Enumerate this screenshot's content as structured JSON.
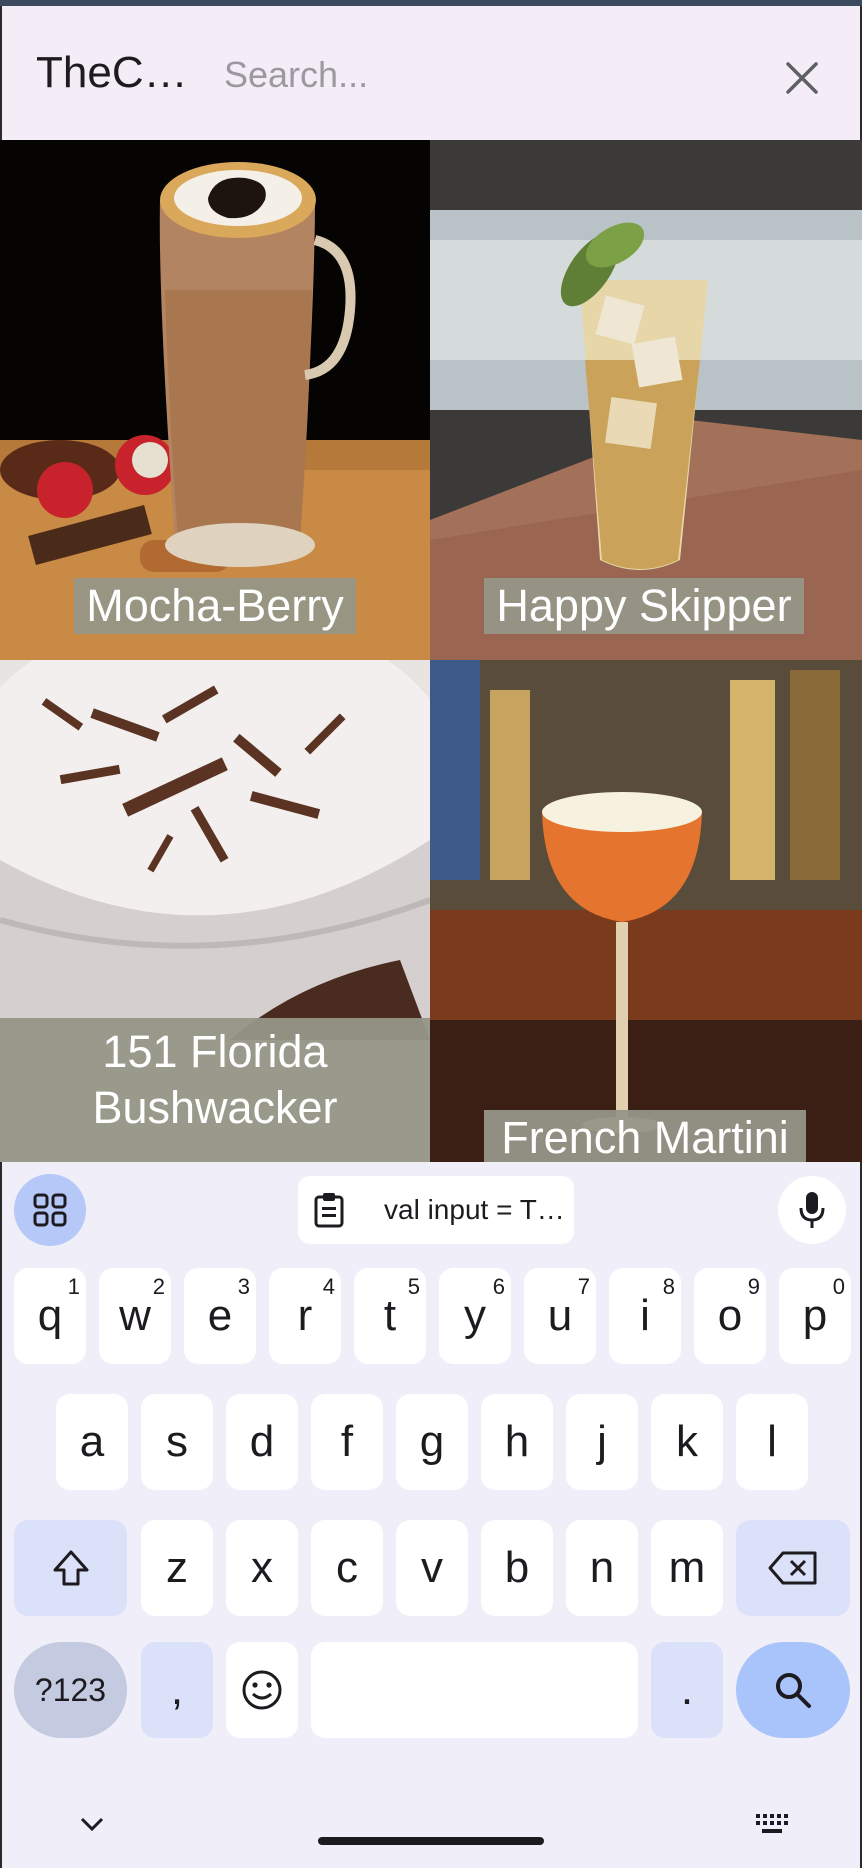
{
  "app": {
    "title": "TheC…",
    "search_placeholder": "Search...",
    "search_value": ""
  },
  "drinks": [
    {
      "name": "Mocha-Berry"
    },
    {
      "name": "Happy Skipper"
    },
    {
      "name": "151 Florida Bushwacker",
      "line1": "151 Florida",
      "line2": "Bushwacker"
    },
    {
      "name": "French Martini"
    }
  ],
  "keyboard": {
    "clipboard_text": "val input = T…",
    "row1": [
      {
        "label": "q",
        "hint": "1"
      },
      {
        "label": "w",
        "hint": "2"
      },
      {
        "label": "e",
        "hint": "3"
      },
      {
        "label": "r",
        "hint": "4"
      },
      {
        "label": "t",
        "hint": "5"
      },
      {
        "label": "y",
        "hint": "6"
      },
      {
        "label": "u",
        "hint": "7"
      },
      {
        "label": "i",
        "hint": "8"
      },
      {
        "label": "o",
        "hint": "9"
      },
      {
        "label": "p",
        "hint": "0"
      }
    ],
    "row2": [
      "a",
      "s",
      "d",
      "f",
      "g",
      "h",
      "j",
      "k",
      "l"
    ],
    "row3": [
      "z",
      "x",
      "c",
      "v",
      "b",
      "n",
      "m"
    ],
    "symbols_label": "?123",
    "comma_label": ",",
    "period_label": "."
  },
  "icons": {
    "close": "close-icon",
    "apps": "apps-grid-icon",
    "clipboard": "clipboard-icon",
    "mic": "microphone-icon",
    "shift": "shift-icon",
    "backspace": "backspace-icon",
    "emoji": "emoji-icon",
    "search": "search-icon",
    "collapse": "chevron-down-icon",
    "switch_keyboard": "keyboard-icon"
  },
  "colors": {
    "appbar_bg": "#f4edf7",
    "keyboard_bg": "#f0eef8",
    "accent_key": "#a8c4fb",
    "caption_bg": "#969687"
  }
}
